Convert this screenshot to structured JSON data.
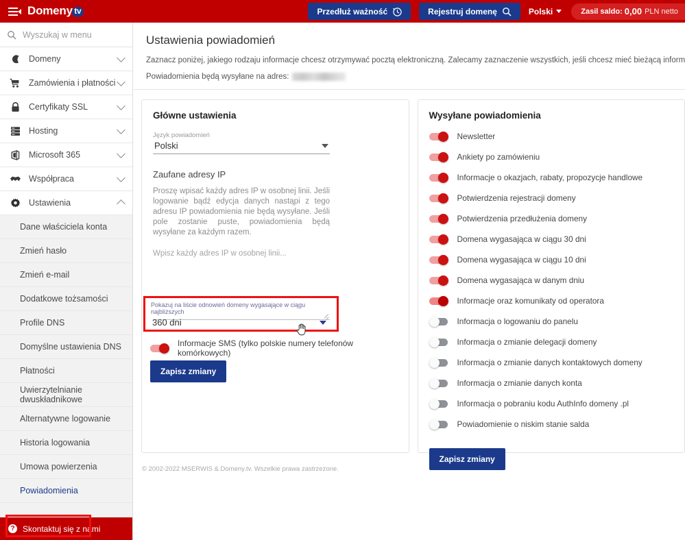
{
  "topbar": {
    "brand": "Domeny",
    "brand_suffix": "tv",
    "extend_button": "Przedłuż ważność",
    "register_button": "Rejestruj domenę",
    "language": "Polski",
    "balance_label": "Zasil saldo:",
    "balance_amount": "0,00",
    "balance_currency": "PLN netto",
    "accent_red": "#c00000",
    "accent_blue": "#1b3a8c"
  },
  "sidebar": {
    "search_placeholder": "Wyszukaj w menu",
    "search_value": "",
    "groups": [
      {
        "label": "Domeny",
        "icon": "globe-icon",
        "expanded": false
      },
      {
        "label": "Zamówienia i płatności",
        "icon": "cart-icon",
        "expanded": false
      },
      {
        "label": "Certyfikaty SSL",
        "icon": "lock-icon",
        "expanded": false
      },
      {
        "label": "Hosting",
        "icon": "server-icon",
        "expanded": false
      },
      {
        "label": "Microsoft 365",
        "icon": "office-icon",
        "expanded": false
      },
      {
        "label": "Współpraca",
        "icon": "handshake-icon",
        "expanded": false
      },
      {
        "label": "Ustawienia",
        "icon": "gear-icon",
        "expanded": true
      }
    ],
    "sub_items": [
      "Dane właściciela konta",
      "Zmień hasło",
      "Zmień e-mail",
      "Dodatkowe tożsamości",
      "Profile DNS",
      "Domyślne ustawienia DNS",
      "Płatności",
      "Uwierzytelnianie dwuskładnikowe",
      "Alternatywne logowanie",
      "Historia logowania",
      "Umowa powierzenia",
      "Powiadomienia"
    ],
    "active_sub_item": "Powiadomienia",
    "contact_label": "Skontaktuj się z nami"
  },
  "page": {
    "title": "Ustawienia powiadomień",
    "description": "Zaznacz poniżej, jakiego rodzaju informacje chcesz otrzymywać pocztą elektroniczną. Zalecamy zaznaczenie wszystkich, jeśli chcesz mieć bieżącą informację o domenach",
    "email_prefix": "Powiadomienia będą wysyłane na adres:",
    "email_value": ""
  },
  "main_settings": {
    "card_title": "Główne ustawienia",
    "language_label": "Język powiadomień",
    "language_value": "Polski",
    "trusted_ip_title": "Zaufane adresy IP",
    "trusted_ip_desc": "Proszę wpisać każdy adres IP w osobnej linii. Jeśli logowanie bądź edycja danych nastąpi z tego adresu IP powiadomienia nie będą wysyłane. Jeśli pole zostanie puste, powiadomienia będą wysyłane za każdym razem.",
    "trusted_ip_placeholder": "Wpisz każdy adres IP w osobnej linii...",
    "trusted_ip_value": "",
    "renewal_label": "Pokazuj na liście odnowień domeny wygasające w ciągu najbliższych",
    "renewal_value": "360 dni",
    "sms_label": "Informacje SMS (tylko polskie numery telefonów komórkowych)",
    "sms_enabled": true,
    "save_label": "Zapisz zmiany"
  },
  "sent_notifications": {
    "card_title": "Wysyłane powiadomienia",
    "save_label": "Zapisz zmiany",
    "items": [
      {
        "label": "Newsletter",
        "on": true,
        "bright": false
      },
      {
        "label": "Ankiety po zamówieniu",
        "on": true,
        "bright": false
      },
      {
        "label": "Informacje o okazjach, rabaty, propozycje handlowe",
        "on": true,
        "bright": false
      },
      {
        "label": "Potwierdzenia rejestracji domeny",
        "on": true,
        "bright": false
      },
      {
        "label": "Potwierdzenia przedłużenia domeny",
        "on": true,
        "bright": false
      },
      {
        "label": "Domena wygasająca w ciągu 30 dni",
        "on": true,
        "bright": false
      },
      {
        "label": "Domena wygasająca w ciągu 10 dni",
        "on": true,
        "bright": false
      },
      {
        "label": "Domena wygasająca w danym dniu",
        "on": true,
        "bright": false
      },
      {
        "label": "Informacje oraz komunikaty od operatora",
        "on": true,
        "bright": true
      },
      {
        "label": "Informacja o logowaniu do panelu",
        "on": false,
        "bright": false
      },
      {
        "label": "Informacja o zmianie delegacji domeny",
        "on": false,
        "bright": false
      },
      {
        "label": "Informacja o zmianie danych kontaktowych domeny",
        "on": false,
        "bright": false
      },
      {
        "label": "Informacja o zmianie danych konta",
        "on": false,
        "bright": false
      },
      {
        "label": "Informacja o pobraniu kodu AuthInfo domeny .pl",
        "on": false,
        "bright": false
      },
      {
        "label": "Powiadomienie o niskim stanie salda",
        "on": false,
        "bright": false
      }
    ]
  },
  "footer": {
    "copyright": "© 2002-2022 MSERWIS & Domeny.tv. Wszelkie prawa zastrzeżone."
  }
}
